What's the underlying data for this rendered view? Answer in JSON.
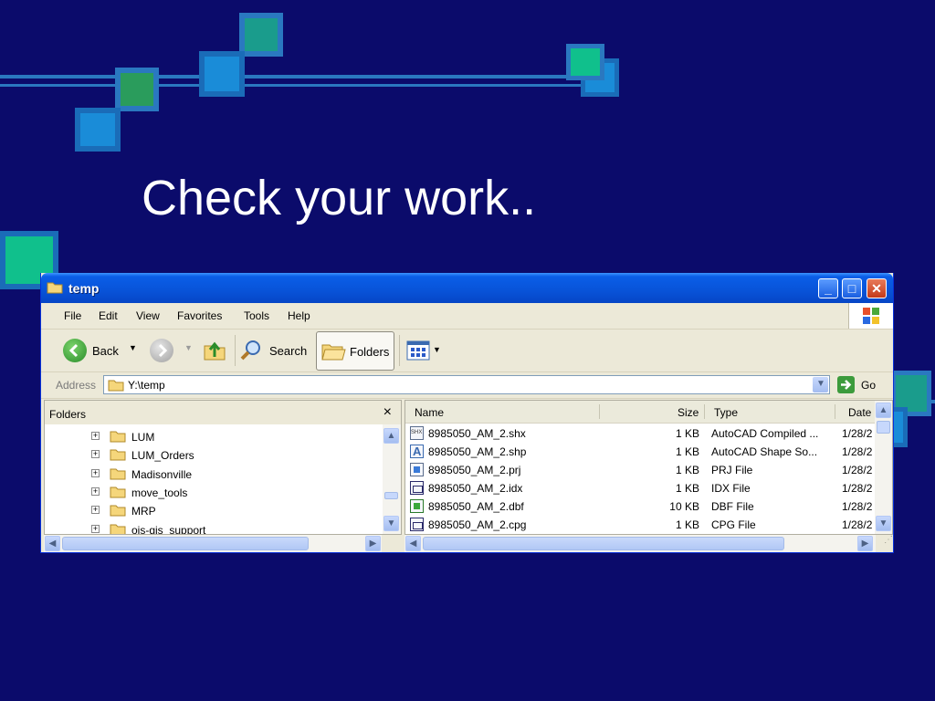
{
  "slide": {
    "title": "Check your work..",
    "colors": {
      "background": "#0b0b6b",
      "line": "#2a78c0",
      "teal": "#1a9c8c",
      "blue": "#1a8cd8",
      "green": "#2a9c5c"
    }
  },
  "window": {
    "title": "temp",
    "icon": "folder-icon",
    "controls": [
      "minimize",
      "maximize",
      "close"
    ]
  },
  "menu": {
    "items": [
      "File",
      "Edit",
      "View",
      "Favorites",
      "Tools",
      "Help"
    ]
  },
  "toolbar": {
    "back_label": "Back",
    "search_label": "Search",
    "folders_label": "Folders"
  },
  "address": {
    "label": "Address",
    "value": "Y:\\temp",
    "go_label": "Go"
  },
  "folders_pane": {
    "title": "Folders",
    "close_glyph": "×",
    "items": [
      "LUM",
      "LUM_Orders",
      "Madisonville",
      "move_tools",
      "MRP",
      "ois-gis_support"
    ]
  },
  "files_pane": {
    "columns": [
      "Name",
      "Size",
      "Type",
      "Date"
    ],
    "rows": [
      {
        "name": "8985050_AM_2.shx",
        "size": "1 KB",
        "type": "AutoCAD Compiled ...",
        "date": "1/28/2",
        "icon": "shx-file-icon"
      },
      {
        "name": "8985050_AM_2.shp",
        "size": "1 KB",
        "type": "AutoCAD Shape So...",
        "date": "1/28/2",
        "icon": "shp-file-icon"
      },
      {
        "name": "8985050_AM_2.prj",
        "size": "1 KB",
        "type": "PRJ File",
        "date": "1/28/2",
        "icon": "prj-file-icon"
      },
      {
        "name": "8985050_AM_2.idx",
        "size": "1 KB",
        "type": "IDX File",
        "date": "1/28/2",
        "icon": "idx-file-icon"
      },
      {
        "name": "8985050_AM_2.dbf",
        "size": "10 KB",
        "type": "DBF File",
        "date": "1/28/2",
        "icon": "dbf-file-icon"
      },
      {
        "name": "8985050_AM_2.cpg",
        "size": "1 KB",
        "type": "CPG File",
        "date": "1/28/2",
        "icon": "cpg-file-icon"
      }
    ]
  }
}
